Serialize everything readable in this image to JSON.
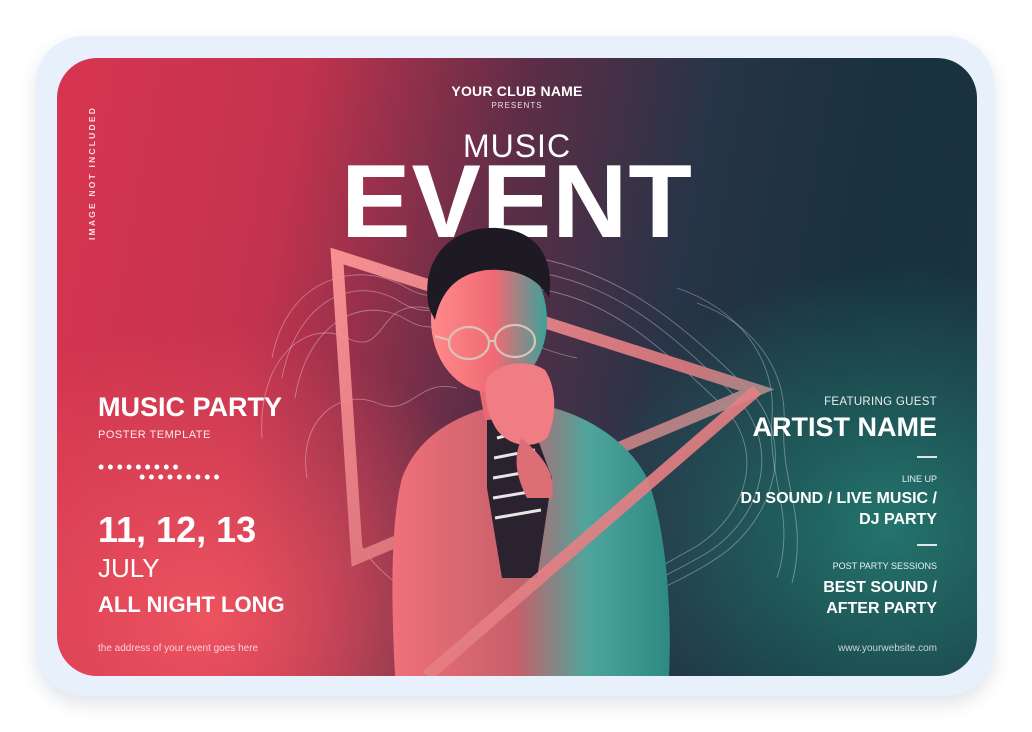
{
  "poster": {
    "side_note": "IMAGE NOT INCLUDED",
    "club_name": "YOUR CLUB NAME",
    "presents": "PRESENTS",
    "music": "MUSIC",
    "event": "EVENT",
    "left": {
      "title": "MUSIC PARTY",
      "subtitle": "POSTER TEMPLATE",
      "dots_row1": "•••••••••",
      "dots_row2": "•••••••••",
      "dates": "11, 12, 13",
      "month": "JULY",
      "tagline": "ALL NIGHT LONG",
      "address": "the address of your event goes here"
    },
    "right": {
      "featuring_label": "FEATURING GUEST",
      "artist": "ARTIST NAME",
      "lineup_label": "LINE UP",
      "lineup_line1": "DJ SOUND / LIVE MUSIC /",
      "lineup_line2": "DJ PARTY",
      "post_label": "POST PARTY SESSIONS",
      "post_line1": "BEST SOUND /",
      "post_line2": "AFTER PARTY",
      "website": "www.yourwebsite.com"
    }
  },
  "colors": {
    "frame": "#e8f0fc",
    "pink": "#e0485e",
    "teal": "#2a7d74",
    "navy": "#1c2c3c"
  },
  "icons": [
    "person-photo",
    "triangle-frame",
    "wave-lines"
  ]
}
